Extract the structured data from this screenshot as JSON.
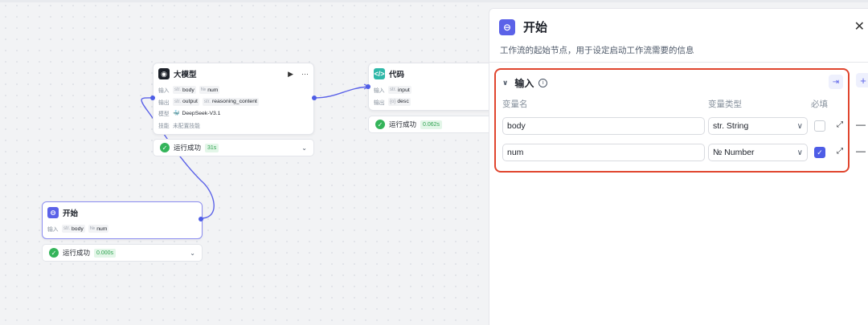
{
  "llm_node": {
    "title": "大模型",
    "run_icon": "▶",
    "more_icon": "···",
    "rows": [
      {
        "key": "输入",
        "tags": [
          {
            "type": "str.",
            "name": "body"
          },
          {
            "type": "№",
            "name": "num"
          }
        ]
      },
      {
        "key": "输出",
        "tags": [
          {
            "type": "str.",
            "name": "output"
          },
          {
            "type": "str.",
            "name": "reasoning_content"
          }
        ]
      }
    ],
    "model_key": "模型",
    "model_value": "DeepSeek-V3.1",
    "skill_key": "技能",
    "skill_value": "未配置技能",
    "status": "运行成功",
    "time": "31s"
  },
  "code_node": {
    "title": "代码",
    "rows": [
      {
        "key": "输入",
        "tags": [
          {
            "type": "str.",
            "name": "input"
          }
        ]
      },
      {
        "key": "输出",
        "tags": [
          {
            "type": "{o}",
            "name": "desc"
          }
        ]
      }
    ],
    "status": "运行成功",
    "time": "0.062s"
  },
  "start_node": {
    "title": "开始",
    "rows": [
      {
        "key": "输入",
        "tags": [
          {
            "type": "str.",
            "name": "body"
          },
          {
            "type": "№",
            "name": "num"
          }
        ]
      }
    ],
    "status": "运行成功",
    "time": "0.000s"
  },
  "panel": {
    "title": "开始",
    "description": "工作流的起始节点，用于设定启动工作流需要的信息",
    "close_icon": "✕",
    "section_title": "输入",
    "col_name": "变量名",
    "col_type": "变量类型",
    "col_required": "必填",
    "variables": [
      {
        "name": "body",
        "type": "str. String",
        "required": false
      },
      {
        "name": "num",
        "type": "№ Number",
        "required": true
      }
    ]
  },
  "colors": {
    "accent": "#4e5de6",
    "success": "#34b45a",
    "highlight": "#e0452e"
  }
}
